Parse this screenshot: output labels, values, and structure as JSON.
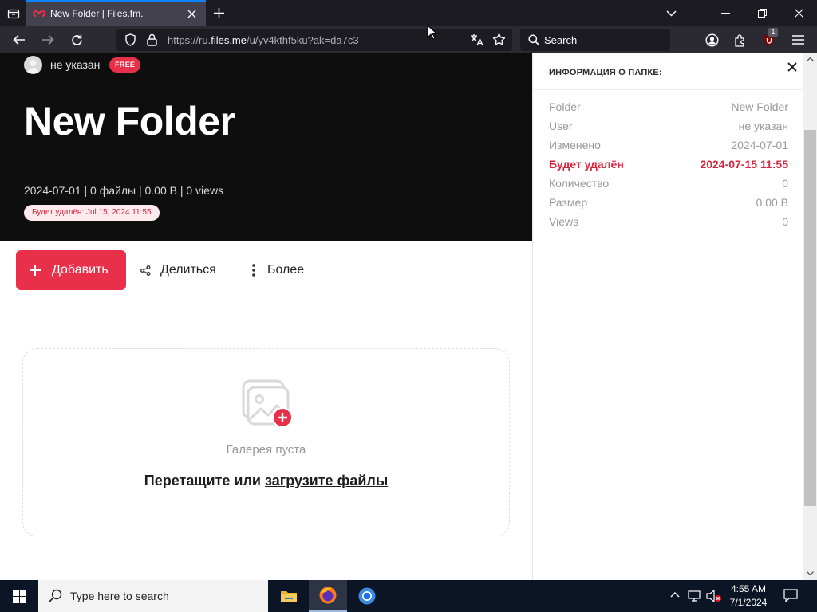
{
  "browser": {
    "tab_title": "New Folder | Files.fm.",
    "url_prefix": "https://ru.",
    "url_host": "files.me",
    "url_rest": "/u/yv4kthf5ku?ak=da7c3",
    "search_label": "Search",
    "extension_badge": "1"
  },
  "hero": {
    "owner": "не указан",
    "plan_badge": "FREE",
    "title": "New Folder",
    "meta": "2024-07-01 | 0 файлы | 0.00  B | 0 views",
    "delete_notice": "Будет удалён: Jul 15, 2024 11:55"
  },
  "toolbar": {
    "add_label": "Добавить",
    "share_label": "Делиться",
    "more_label": "Более"
  },
  "dropzone": {
    "empty_text": "Галерея пуста",
    "drop_text": "Перетащите или ",
    "upload_link": "загрузите файлы"
  },
  "info_panel": {
    "title": "ИНФОРМАЦИЯ О ПАПКЕ:",
    "rows": [
      {
        "key": "Folder",
        "value": "New Folder"
      },
      {
        "key": "User",
        "value": "не указан"
      },
      {
        "key": "Изменено",
        "value": "2024-07-01"
      },
      {
        "key": "Будет удалён",
        "value": "2024-07-15 11:55"
      },
      {
        "key": "Количество",
        "value": "0"
      },
      {
        "key": "Размер",
        "value": "0.00  B"
      },
      {
        "key": "Views",
        "value": "0"
      }
    ]
  },
  "taskbar": {
    "search_placeholder": "Type here to search",
    "time": "4:55 AM",
    "date": "7/1/2024"
  },
  "colors": {
    "accent": "#e8304a",
    "browser_dark": "#1c1b22",
    "hero_bg": "#0e0e0e"
  }
}
